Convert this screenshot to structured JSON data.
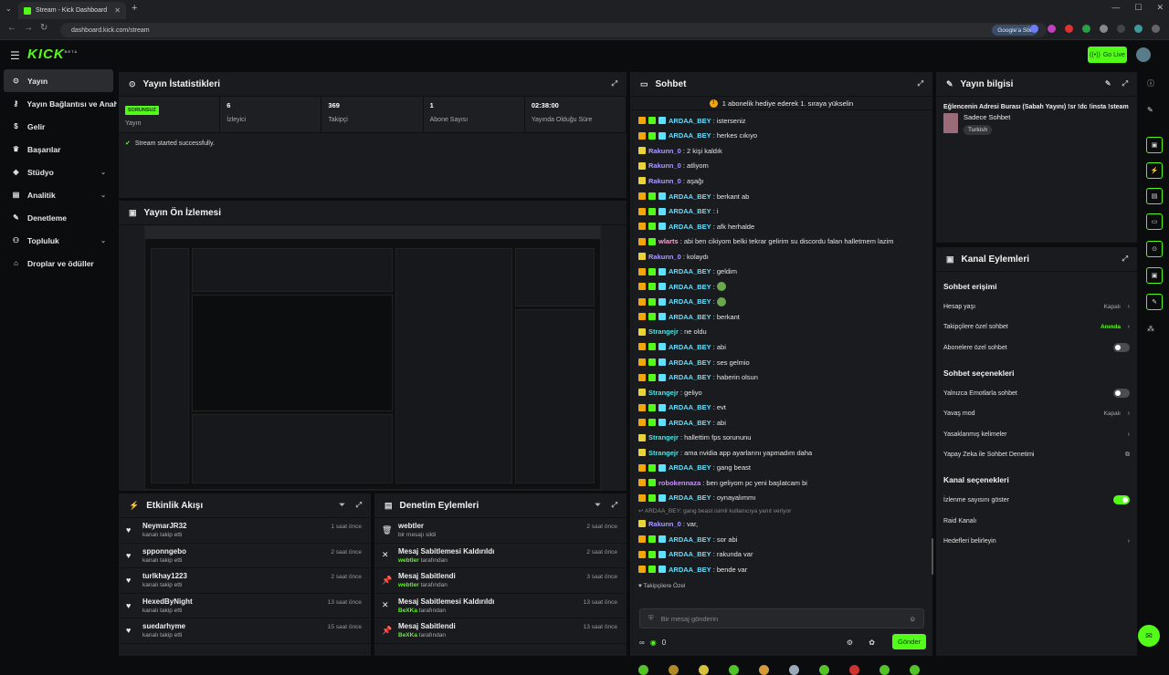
{
  "browser": {
    "tab_title": "Stream - Kick Dashboard",
    "url": "dashboard.kick.com/stream",
    "google_btn": "Google'a Sor"
  },
  "topbar": {
    "logo": "KICK",
    "logo_sup": "BETA",
    "go_live": "Go Live"
  },
  "sidebar": {
    "items": [
      {
        "label": "Yayın",
        "icon": "circle-icon",
        "active": true
      },
      {
        "label": "Yayın Bağlantısı ve Anahtarı",
        "icon": "key-icon"
      },
      {
        "label": "Gelir",
        "icon": "dollar-icon"
      },
      {
        "label": "Başarılar",
        "icon": "trophy-icon"
      },
      {
        "label": "Stüdyo",
        "icon": "layers-icon",
        "chev": true
      },
      {
        "label": "Analitik",
        "icon": "chart-icon",
        "chev": true
      },
      {
        "label": "Denetleme",
        "icon": "wrench-icon"
      },
      {
        "label": "Topluluk",
        "icon": "users-icon",
        "chev": true
      },
      {
        "label": "Droplar ve ödüller",
        "icon": "gift-icon"
      }
    ]
  },
  "stats_panel": {
    "title": "Yayın İstatistikleri",
    "status_badge": "SORUNSUZ",
    "status_label": "Yayın",
    "viewers_value": "6",
    "viewers_label": "İzleyici",
    "followers_value": "369",
    "followers_label": "Takipçi",
    "subs_value": "1",
    "subs_label": "Abone Sayısı",
    "uptime_value": "02:38:00",
    "uptime_label": "Yayında Olduğu Süre",
    "message": "Stream started successfully."
  },
  "preview_panel": {
    "title": "Yayın Ön İzlemesi"
  },
  "activity_feed": {
    "title": "Etkinlik Akışı",
    "items": [
      {
        "name": "NeymarJR32",
        "sub": "kanalı takip etti",
        "time": "1 saat önce"
      },
      {
        "name": "spponngebo",
        "sub": "kanalı takip etti",
        "time": "2 saat önce"
      },
      {
        "name": "turlkhay1223",
        "sub": "kanalı takip etti",
        "time": "2 saat önce"
      },
      {
        "name": "HexedByNight",
        "sub": "kanalı takip etti",
        "time": "13 saat önce"
      },
      {
        "name": "suedarhyme",
        "sub": "kanalı takip etti",
        "time": "15 saat önce"
      }
    ]
  },
  "mod_actions": {
    "title": "Denetim Eylemleri",
    "items": [
      {
        "name": "webtler",
        "sub_user": "",
        "sub_text": "bir mesajı sildi",
        "time": "2 saat önce",
        "icon": "trash-icon"
      },
      {
        "name": "Mesaj Sabitlemesi Kaldırıldı",
        "sub_user": "webtler",
        "sub_text": " tarafından",
        "time": "2 saat önce",
        "icon": "unpin-icon"
      },
      {
        "name": "Mesaj Sabitlendi",
        "sub_user": "webtler",
        "sub_text": " tarafından",
        "time": "3 saat önce",
        "icon": "pin-icon"
      },
      {
        "name": "Mesaj Sabitlemesi Kaldırıldı",
        "sub_user": "BeXKa",
        "sub_text": " tarafından",
        "time": "13 saat önce",
        "icon": "unpin-icon"
      },
      {
        "name": "Mesaj Sabitlendi",
        "sub_user": "BeXKa",
        "sub_text": " tarafından",
        "time": "13 saat önce",
        "icon": "pin-icon"
      }
    ]
  },
  "chat": {
    "title": "Sohbet",
    "pinned": "1 abonelik hediye ederek 1. sıraya yükselin",
    "colors": {
      "ardaa": "#5ee0ff",
      "rakunn": "#a89cff",
      "wlarts": "#ff9fd6",
      "strangejr": "#4fe3e3",
      "robokennaza": "#c790ff"
    },
    "messages": [
      {
        "user": "ARDAA_BEY",
        "text": ": isterseniz",
        "c": "ardaa",
        "b": 3
      },
      {
        "user": "ARDAA_BEY",
        "text": ": herkes cıkıyo",
        "c": "ardaa",
        "b": 3
      },
      {
        "user": "Rakunn_0",
        "text": ": 2 kişi kaldık",
        "c": "rakunn",
        "b": 1
      },
      {
        "user": "Rakunn_0",
        "text": ": atliyom",
        "c": "rakunn",
        "b": 1
      },
      {
        "user": "Rakunn_0",
        "text": ": aşağı",
        "c": "rakunn",
        "b": 1
      },
      {
        "user": "ARDAA_BEY",
        "text": ": berkant ab",
        "c": "ardaa",
        "b": 3
      },
      {
        "user": "ARDAA_BEY",
        "text": ": i",
        "c": "ardaa",
        "b": 3
      },
      {
        "user": "ARDAA_BEY",
        "text": ": afk herhalde",
        "c": "ardaa",
        "b": 3
      },
      {
        "user": "wlarts",
        "text": ": abi ben cikiyom belki tekrar gelirim su discordu falan halletmem lazim",
        "c": "wlarts",
        "b": 2
      },
      {
        "user": "Rakunn_0",
        "text": ": kolaydı",
        "c": "rakunn",
        "b": 1
      },
      {
        "user": "ARDAA_BEY",
        "text": ": geldim",
        "c": "ardaa",
        "b": 3
      },
      {
        "user": "ARDAA_BEY",
        "text": ": ",
        "c": "ardaa",
        "b": 3,
        "emote": true
      },
      {
        "user": "ARDAA_BEY",
        "text": ": ",
        "c": "ardaa",
        "b": 3,
        "emote": true
      },
      {
        "user": "ARDAA_BEY",
        "text": ": berkant",
        "c": "ardaa",
        "b": 3
      },
      {
        "user": "Strangejr",
        "text": ": ne oldu",
        "c": "strangejr",
        "b": 1
      },
      {
        "user": "ARDAA_BEY",
        "text": ": abi",
        "c": "ardaa",
        "b": 3
      },
      {
        "user": "ARDAA_BEY",
        "text": ": ses gelmio",
        "c": "ardaa",
        "b": 3
      },
      {
        "user": "ARDAA_BEY",
        "text": ": haberin olsun",
        "c": "ardaa",
        "b": 3
      },
      {
        "user": "Strangejr",
        "text": ": geliyo",
        "c": "strangejr",
        "b": 1
      },
      {
        "user": "ARDAA_BEY",
        "text": ": evt",
        "c": "ardaa",
        "b": 3
      },
      {
        "user": "ARDAA_BEY",
        "text": ": abi",
        "c": "ardaa",
        "b": 3
      },
      {
        "user": "Strangejr",
        "text": ": hallettim fps sorununu",
        "c": "strangejr",
        "b": 1
      },
      {
        "user": "Strangejr",
        "text": ": ama nvidia app ayarlarını yapmadım daha",
        "c": "strangejr",
        "b": 1
      },
      {
        "user": "ARDAA_BEY",
        "text": ": gang beast",
        "c": "ardaa",
        "b": 3
      },
      {
        "user": "robokennaza",
        "text": ": ben geliyom pc yeni başlatcam bi",
        "c": "robokennaza",
        "b": 2
      },
      {
        "user": "ARDAA_BEY",
        "text": ": oynayalımmı",
        "c": "ardaa",
        "b": 3
      }
    ],
    "system_msg": "↩ ARDAA_BEY: gang beast isimli kullanıcıya yanıt veriyor",
    "after": [
      {
        "user": "Rakunn_0",
        "text": ": var,",
        "c": "rakunn",
        "b": 1
      },
      {
        "user": "ARDAA_BEY",
        "text": ": sor abi",
        "c": "ardaa",
        "b": 3
      },
      {
        "user": "ARDAA_BEY",
        "text": ": rakunda var",
        "c": "ardaa",
        "b": 3
      },
      {
        "user": "ARDAA_BEY",
        "text": ": bende var",
        "c": "ardaa",
        "b": 3
      }
    ],
    "followers_only": "♥ Takipçilere Özel",
    "input_placeholder": "Bir mesaj gönderin",
    "viewer_count": "0",
    "send_label": "Gönder"
  },
  "stream_info": {
    "title": "Yayın bilgisi",
    "stream_title": "Eğlencenin Adresi Burası (Sabah Yayını) !sr !dc !insta !steam",
    "category": "Sadece Sohbet",
    "tag": "Turkish"
  },
  "channel_actions": {
    "title": "Kanal Eylemleri",
    "sec1": "Sohbet erişimi",
    "r1": "Hesap yaşı",
    "r1v": "Kapalı",
    "r2": "Takipçilere özel sohbet",
    "r2v": "Anında",
    "r3": "Abonelere özel sohbet",
    "sec2": "Sohbet seçenekleri",
    "r4": "Yalnızca Emotlarla sohbet",
    "r5": "Yavaş mod",
    "r5v": "Kapalı",
    "r6": "Yasaklanmış kelimeler",
    "r7": "Yapay Zeka ile Sohbet Denetimi",
    "sec3": "Kanal seçenekleri",
    "r8": "İzlenme sayısını göster",
    "r9": "Raid Kanalı",
    "r10": "Hedefleri belirleyin"
  }
}
